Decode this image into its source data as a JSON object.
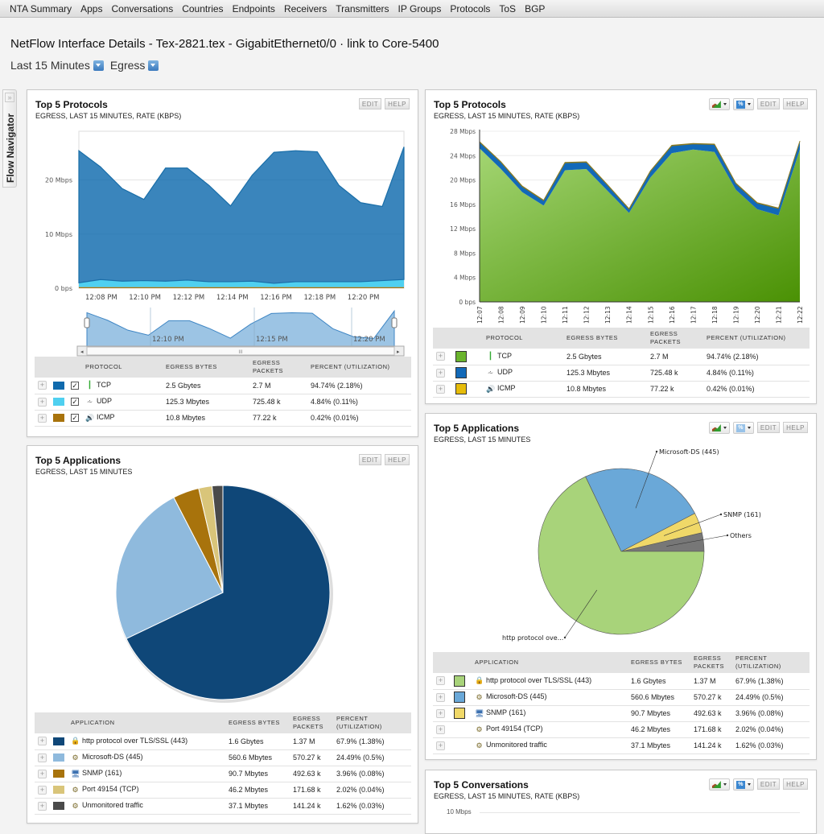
{
  "topnav": [
    "NTA Summary",
    "Apps",
    "Conversations",
    "Countries",
    "Endpoints",
    "Receivers",
    "Transmitters",
    "IP Groups",
    "Protocols",
    "ToS",
    "BGP"
  ],
  "page": {
    "title": "NetFlow Interface Details - Tex-2821.tex - GigabitEthernet0/0 · link to Core-5400",
    "time_filter": "Last 15 Minutes",
    "direction_filter": "Egress"
  },
  "flow_navigator": {
    "label": "Flow Navigator",
    "arrows": "»"
  },
  "buttons": {
    "edit": "EDIT",
    "help": "HELP",
    "pct": "%"
  },
  "protocol_table": {
    "headers": [
      "PROTOCOL",
      "EGRESS BYTES",
      "EGRESS PACKETS",
      "PERCENT (UTILIZATION)"
    ],
    "rows": [
      {
        "icon": "tcp-icon",
        "name": "TCP",
        "bytes": "2.5 Gbytes",
        "packets": "2.7 M",
        "percent": "94.74% (2.18%)"
      },
      {
        "icon": "udp-icon",
        "name": "UDP",
        "bytes": "125.3 Mbytes",
        "packets": "725.48 k",
        "percent": "4.84% (0.11%)"
      },
      {
        "icon": "icmp-icon",
        "name": "ICMP",
        "bytes": "10.8 Mbytes",
        "packets": "77.22 k",
        "percent": "0.42% (0.01%)"
      }
    ]
  },
  "app_table": {
    "headers": [
      "APPLICATION",
      "EGRESS BYTES",
      "EGRESS PACKETS",
      "PERCENT (UTILIZATION)"
    ],
    "rows": [
      {
        "icon": "lock-icon",
        "name": "http protocol over TLS/SSL (443)",
        "bytes": "1.6 Gbytes",
        "packets": "1.37 M",
        "percent": "67.9% (1.38%)"
      },
      {
        "icon": "gears-icon",
        "name": "Microsoft-DS (445)",
        "bytes": "560.6 Mbytes",
        "packets": "570.27 k",
        "percent": "24.49% (0.5%)"
      },
      {
        "icon": "snmp-icon",
        "name": "SNMP (161)",
        "bytes": "90.7 Mbytes",
        "packets": "492.63 k",
        "percent": "3.96% (0.08%)"
      },
      {
        "icon": "gears-icon",
        "name": "Port 49154 (TCP)",
        "bytes": "46.2 Mbytes",
        "packets": "171.68 k",
        "percent": "2.02% (0.04%)"
      },
      {
        "icon": "gears-icon",
        "name": "Unmonitored traffic",
        "bytes": "37.1 Mbytes",
        "packets": "141.24 k",
        "percent": "1.62% (0.03%)"
      }
    ]
  },
  "panels": {
    "protocols_left": {
      "title": "Top 5 Protocols",
      "subtitle": "EGRESS, LAST 15 MINUTES, RATE (KBPS)",
      "colors": [
        "#0f6aad",
        "#4fd0f0",
        "#a8730c"
      ]
    },
    "protocols_right": {
      "title": "Top 5 Protocols",
      "subtitle": "EGRESS, LAST 15 MINUTES, RATE (KBPS)",
      "colors": [
        "#6ab42d",
        "#1269b8",
        "#e6bc0a"
      ]
    },
    "apps_left": {
      "title": "Top 5 Applications",
      "subtitle": "EGRESS, LAST 15 MINUTES",
      "colors": [
        "#0f4778",
        "#8fbadd",
        "#a8730c",
        "#d9c57a",
        "#4a4a4a"
      ]
    },
    "apps_right": {
      "title": "Top 5 Applications",
      "subtitle": "EGRESS, LAST 15 MINUTES",
      "colors": [
        "#a8d37a",
        "#6aa8d8",
        "#f0d868"
      ]
    },
    "conversations": {
      "title": "Top 5 Conversations",
      "subtitle": "EGRESS, LAST 15 MINUTES, RATE (KBPS)",
      "y_top_label": "10 Mbps"
    }
  },
  "chart_data": [
    {
      "type": "area",
      "title": "Top 5 Protocols (stacked area, interactive)",
      "xlabel": "",
      "ylabel": "",
      "x_tick_labels": [
        "12:08 PM",
        "12:10 PM",
        "12:12 PM",
        "12:14 PM",
        "12:16 PM",
        "12:18 PM",
        "12:20 PM"
      ],
      "y_tick_labels": [
        "0 bps",
        "10 Mbps",
        "20 Mbps"
      ],
      "ylim": [
        0,
        29
      ],
      "x": [
        "12:07",
        "12:08",
        "12:09",
        "12:10",
        "12:11",
        "12:12",
        "12:13",
        "12:14",
        "12:15",
        "12:16",
        "12:17",
        "12:18",
        "12:19",
        "12:20",
        "12:21",
        "12:22"
      ],
      "series": [
        {
          "name": "ICMP",
          "values": [
            0.2,
            0.2,
            0.2,
            0.2,
            0.2,
            0.2,
            0.2,
            0.2,
            0.2,
            0.2,
            0.2,
            0.2,
            0.2,
            0.2,
            0.2,
            0.2
          ]
        },
        {
          "name": "UDP",
          "values": [
            0.8,
            1.4,
            1.1,
            1.2,
            1.1,
            1.3,
            1.0,
            1.0,
            1.1,
            0.7,
            1.0,
            1.0,
            1.0,
            1.0,
            1.2,
            1.4
          ]
        },
        {
          "name": "TCP",
          "values": [
            24.4,
            20.8,
            17.1,
            15.0,
            20.9,
            20.7,
            17.8,
            14.0,
            19.6,
            24.2,
            24.2,
            24.0,
            17.8,
            14.6,
            13.7,
            24.5
          ]
        }
      ],
      "navigator_labels": [
        "12:10 PM",
        "12:15 PM",
        "12:20 PM"
      ],
      "grid": true
    },
    {
      "type": "area",
      "title": "Top 5 Protocols (stacked area)",
      "xlabel": "",
      "ylabel": "",
      "x": [
        "12:07",
        "12:08",
        "12:09",
        "12:10",
        "12:11",
        "12:12",
        "12:13",
        "12:14",
        "12:15",
        "12:16",
        "12:17",
        "12:18",
        "12:19",
        "12:20",
        "12:21",
        "12:22"
      ],
      "y_tick_labels": [
        "0 bps",
        "4 Mbps",
        "8 Mbps",
        "12 Mbps",
        "16 Mbps",
        "20 Mbps",
        "24 Mbps",
        "28 Mbps"
      ],
      "ylim": [
        0,
        28
      ],
      "series": [
        {
          "name": "TCP",
          "values": [
            25.2,
            21.8,
            18.0,
            15.8,
            21.6,
            21.8,
            18.2,
            14.6,
            20.4,
            24.4,
            25.0,
            24.6,
            18.4,
            15.2,
            14.2,
            25.0
          ]
        },
        {
          "name": "UDP",
          "values": [
            1.0,
            1.1,
            0.9,
            0.8,
            1.2,
            1.1,
            0.9,
            0.6,
            1.0,
            1.2,
            0.9,
            1.2,
            1.0,
            1.0,
            1.1,
            1.3
          ]
        },
        {
          "name": "ICMP",
          "values": [
            0.1,
            0.1,
            0.1,
            0.1,
            0.1,
            0.1,
            0.1,
            0.1,
            0.1,
            0.1,
            0.1,
            0.1,
            0.1,
            0.1,
            0.1,
            0.1
          ]
        }
      ],
      "grid": true
    },
    {
      "type": "pie",
      "title": "Top 5 Applications",
      "labels": [
        "http protocol over TLS/SSL (443)",
        "Microsoft-DS (445)",
        "SNMP (161)",
        "Port 49154 (TCP)",
        "Unmonitored traffic"
      ],
      "values": [
        67.9,
        24.49,
        3.96,
        2.02,
        1.62
      ]
    },
    {
      "type": "pie",
      "title": "Top 5 Applications",
      "labels": [
        "http protocol ove...",
        "Microsoft-DS (445)",
        "SNMP (161)",
        "Others"
      ],
      "values": [
        67.9,
        24.49,
        3.96,
        3.64
      ]
    }
  ]
}
